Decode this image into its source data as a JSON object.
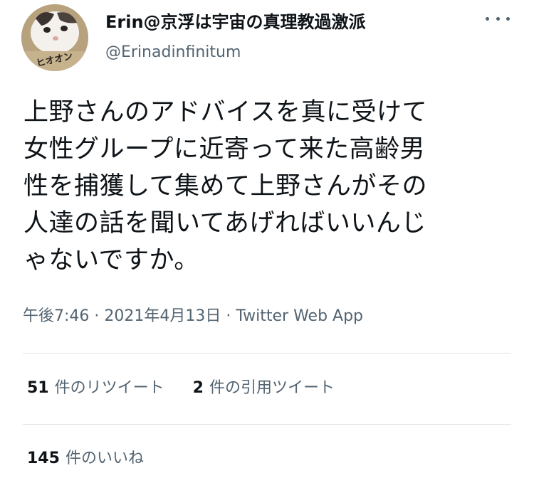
{
  "user": {
    "display_name": "Erin@京浮は宇宙の真理教過激派",
    "handle": "@Erinadinfinitum",
    "avatar_icon": "cat-avatar",
    "avatar_text": "ヒオオン"
  },
  "tweet": {
    "lines": [
      "上野さんのアドバイスを真に受けて",
      "女性グループに近寄って来た高齢男",
      "性を捕獲して集めて上野さんがその",
      "人達の話を聞いてあげればいいんじ",
      "ゃないですか。"
    ]
  },
  "meta": {
    "time": "午後7:46",
    "separator": " · ",
    "date": "2021年4月13日",
    "source": "Twitter Web App"
  },
  "stats": {
    "retweets": {
      "count": "51",
      "label": "件のリツイート"
    },
    "quotes": {
      "count": "2",
      "label": "件の引用ツイート"
    },
    "likes": {
      "count": "145",
      "label": "件のいいね"
    }
  },
  "colors": {
    "text": "#0f1419",
    "secondary": "#536471",
    "divider": "#dfe3e6"
  }
}
